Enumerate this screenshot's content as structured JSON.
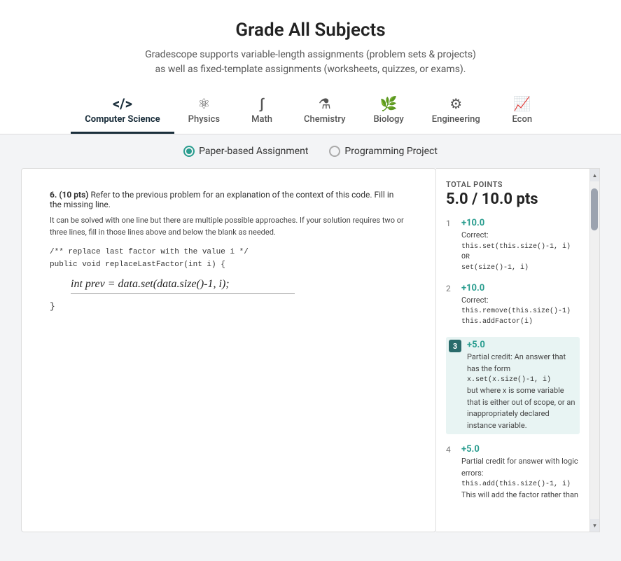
{
  "header": {
    "title": "Grade All Subjects",
    "subtitle_line1": "Gradescope supports variable-length assignments (problem sets & projects)",
    "subtitle_line2": "as well as fixed-template assignments (worksheets, quizzes, or exams)."
  },
  "tabs": [
    {
      "id": "computer-science",
      "label": "Computer Science",
      "icon": "</>",
      "active": true
    },
    {
      "id": "physics",
      "label": "Physics",
      "icon": "⚛",
      "active": false
    },
    {
      "id": "math",
      "label": "Math",
      "icon": "∫",
      "active": false
    },
    {
      "id": "chemistry",
      "label": "Chemistry",
      "icon": "⚗",
      "active": false
    },
    {
      "id": "biology",
      "label": "Biology",
      "icon": "🌿",
      "active": false
    },
    {
      "id": "engineering",
      "label": "Engineering",
      "icon": "⚙",
      "active": false
    },
    {
      "id": "econ",
      "label": "Econ",
      "icon": "📈",
      "active": false
    }
  ],
  "assignment_types": [
    {
      "id": "paper",
      "label": "Paper-based Assignment",
      "selected": true
    },
    {
      "id": "programming",
      "label": "Programming Project",
      "selected": false
    }
  ],
  "question": {
    "number": "6",
    "points": "10",
    "text": "6. (10 pts) Refer to the previous problem for an explanation of the context of this code. Fill in the missing line.",
    "context": "It can be solved with one line but there are multiple possible approaches. If your solution requires two or three lines, fill in those lines above and below the blank as needed.",
    "code_before": "/** replace last factor with the value i */\npublic void replaceLastFactor(int i) {",
    "handwritten_answer": "int prev = data.set(data.size()-1, i);",
    "code_after": "}"
  },
  "rubric": {
    "total_label": "TOTAL POINTS",
    "total_value": "5.0 / 10.0 pts",
    "items": [
      {
        "num": "1",
        "score": "+10.0",
        "highlight": false,
        "description": "Correct:",
        "code": "this.set(this.size()-1, i)\nOR\nset(size()-1, i)"
      },
      {
        "num": "2",
        "score": "+10.0",
        "highlight": false,
        "description": "Correct:",
        "code": "this.remove(this.size()-1)\nthis.addFactor(i)"
      },
      {
        "num": "3",
        "score": "+5.0",
        "highlight": true,
        "description": "Partial credit: An answer that has the form",
        "code": "x.set(x.size()-1, i)",
        "description2": "but where x is some variable that is either out of scope, or an inappropriately declared instance variable."
      },
      {
        "num": "4",
        "score": "+5.0",
        "highlight": false,
        "description": "Partial credit for answer with logic errors:",
        "code": "this.add(this.size()-1, i)",
        "description2": "This will add the factor rather than"
      }
    ]
  }
}
